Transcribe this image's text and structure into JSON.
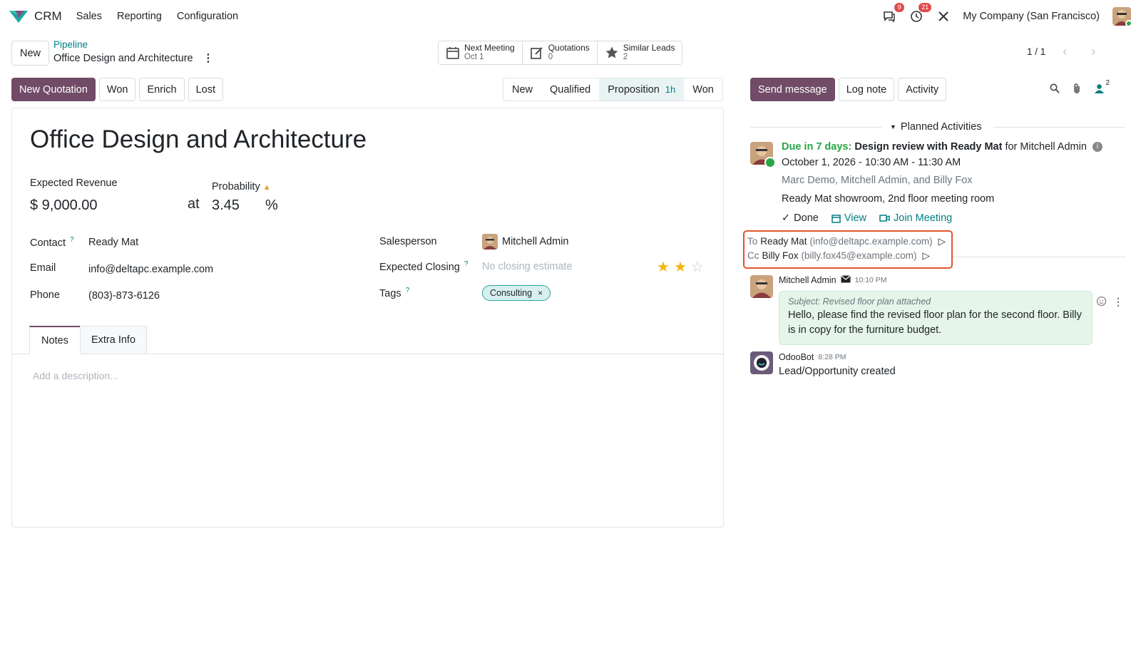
{
  "app": {
    "name": "CRM",
    "menu": [
      "Sales",
      "Reporting",
      "Configuration"
    ],
    "messages_badge": "9",
    "activities_badge": "21",
    "company": "My Company (San Francisco)"
  },
  "control": {
    "new_label": "New",
    "breadcrumb_parent": "Pipeline",
    "breadcrumb_current": "Office Design and Architecture",
    "smart_buttons": [
      {
        "title": "Next Meeting",
        "value": "Oct 1"
      },
      {
        "title": "Quotations",
        "value": "0"
      },
      {
        "title": "Similar Leads",
        "value": "2"
      }
    ],
    "pager": "1 / 1"
  },
  "header_buttons": {
    "new_quotation": "New Quotation",
    "won": "Won",
    "enrich": "Enrich",
    "lost": "Lost"
  },
  "stages": {
    "items": [
      "New",
      "Qualified",
      "Proposition",
      "Won"
    ],
    "active": "Proposition",
    "active_duration": "1h"
  },
  "form": {
    "title": "Office Design and Architecture",
    "expected_revenue_label": "Expected Revenue",
    "expected_revenue": "$ 9,000.00",
    "at": "at",
    "probability_label": "Probability",
    "probability": "3.45",
    "percent": "%",
    "contact_label": "Contact",
    "contact": "Ready Mat",
    "email_label": "Email",
    "email": "info@deltapc.example.com",
    "phone_label": "Phone",
    "phone": "(803)-873-6126",
    "salesperson_label": "Salesperson",
    "salesperson": "Mitchell Admin",
    "expected_closing_label": "Expected Closing",
    "expected_closing_placeholder": "No closing estimate",
    "priority_stars": 2,
    "priority_max": 3,
    "tags_label": "Tags",
    "tag": "Consulting",
    "help_mark": "?",
    "tabs": [
      "Notes",
      "Extra Info"
    ],
    "description_placeholder": "Add a description..."
  },
  "chatter": {
    "send_message": "Send message",
    "log_note": "Log note",
    "activity": "Activity",
    "followers_count": "2",
    "planned_activities": "Planned Activities",
    "activity_item": {
      "due": "Due in 7 days:",
      "summary": "Design review with Ready Mat",
      "for": "for Mitchell Admin",
      "datetime": "October 1, 2026 - 10:30 AM - 11:30 AM",
      "attendees": "Marc Demo, Mitchell Admin, and Billy Fox",
      "location": "Ready Mat showroom, 2nd floor meeting room",
      "done": "Done",
      "view": "View",
      "join": "Join Meeting"
    },
    "recipients": {
      "to_label": "To",
      "to_name": "Ready Mat",
      "to_email": "(info@deltapc.example.com)",
      "cc_label": "Cc",
      "cc_name": "Billy Fox",
      "cc_email": "(billy.fox45@example.com)"
    },
    "messages": [
      {
        "author": "Mitchell Admin",
        "time": "10:10 PM",
        "subject": "Subject: Revised floor plan attached",
        "body": "Hello, please find the revised floor plan for the second floor. Billy is in copy for the furniture budget."
      },
      {
        "author": "OdooBot",
        "time": "8:28 PM",
        "body": "Lead/Opportunity created"
      }
    ]
  },
  "colors": {
    "primary": "#714b67",
    "teal": "#017e84",
    "due_green": "#28a745",
    "highlight": "#e0552d"
  }
}
